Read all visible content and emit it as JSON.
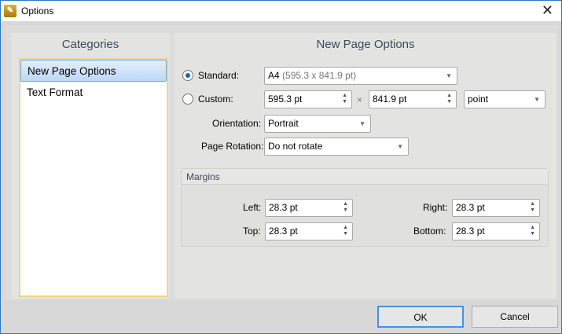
{
  "window": {
    "title": "Options",
    "close": "✕"
  },
  "categories": {
    "header": "Categories",
    "items": [
      {
        "label": "New Page Options",
        "selected": true
      },
      {
        "label": "Text Format",
        "selected": false
      }
    ]
  },
  "main": {
    "header": "New Page Options",
    "standard_label": "Standard:",
    "standard_value": "A4",
    "standard_dims": "(595.3 x 841.9 pt)",
    "custom_label": "Custom:",
    "width": "595.3 pt",
    "times": "×",
    "height": "841.9 pt",
    "unit": "point",
    "orientation_label": "Orientation:",
    "orientation": "Portrait",
    "rotation_label": "Page Rotation:",
    "rotation": "Do not rotate",
    "margins": {
      "header": "Margins",
      "left_label": "Left:",
      "left": "28.3 pt",
      "top_label": "Top:",
      "top": "28.3 pt",
      "right_label": "Right:",
      "right": "28.3 pt",
      "bottom_label": "Bottom:",
      "bottom": "28.3 pt"
    }
  },
  "buttons": {
    "ok": "OK",
    "cancel": "Cancel"
  }
}
